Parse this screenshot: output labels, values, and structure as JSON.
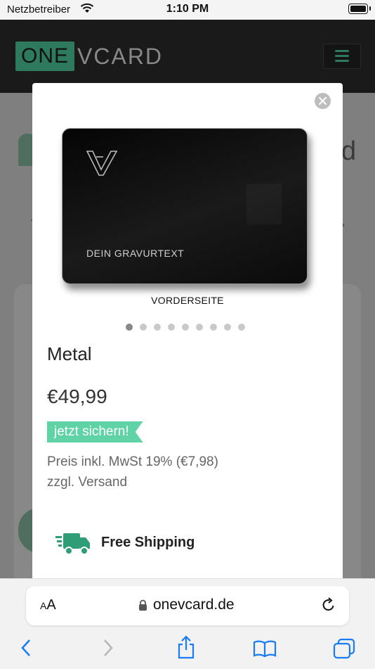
{
  "status_bar": {
    "carrier": "Netzbetreiber",
    "time": "1:10 PM"
  },
  "site": {
    "logo_one": "ONE",
    "logo_vcard": "VCARD",
    "bg_partial_char": "d"
  },
  "modal": {
    "card_engraving": "DEIN GRAVURTEXT",
    "card_caption": "VORDERSEITE",
    "carousel_count": 9,
    "carousel_active": 0,
    "product_title": "Metal",
    "price": "€49,99",
    "badge": "jetzt sichern!",
    "tax_note": "Preis inkl. MwSt 19% (€7,98)",
    "shipping_note": "zzgl. Versand",
    "free_shipping": "Free Shipping"
  },
  "browser": {
    "text_size_label": "AA",
    "url": "onevcard.de"
  },
  "colors": {
    "brand_green": "#2d7a5f",
    "badge_green": "#5fd3a6",
    "ios_blue": "#1a7cf5"
  }
}
